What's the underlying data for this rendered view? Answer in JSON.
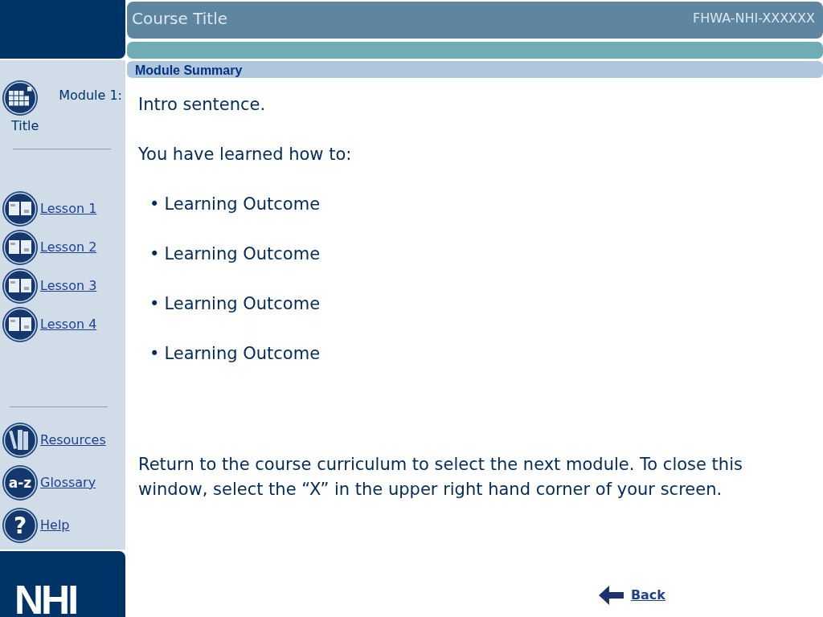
{
  "header": {
    "course_title": "Course Title",
    "course_code": "FHWA-NHI-XXXXXX"
  },
  "section_title": "Module Summary",
  "sidebar": {
    "module_label": "Module 1:",
    "module_title": "Title",
    "lessons": [
      "Lesson 1",
      "Lesson 2",
      "Lesson 3",
      "Lesson 4"
    ],
    "tools": [
      {
        "kind": "resources",
        "label": "Resources"
      },
      {
        "kind": "glossary",
        "label": "Glossary",
        "icon_text": "a-z"
      },
      {
        "kind": "help",
        "label": "Help",
        "icon_text": "?"
      }
    ]
  },
  "content": {
    "intro": "Intro sentence.",
    "lead": "You have learned how to:",
    "outcomes": [
      "Learning Outcome",
      "Learning Outcome",
      "Learning Outcome",
      "Learning Outcome"
    ],
    "bullet": "•",
    "closing": "Return to the course curriculum to select the next module. To close this window, select the “X” in the upper right hand corner of your screen."
  },
  "back_link": "Back",
  "logo_text": "NHI"
}
